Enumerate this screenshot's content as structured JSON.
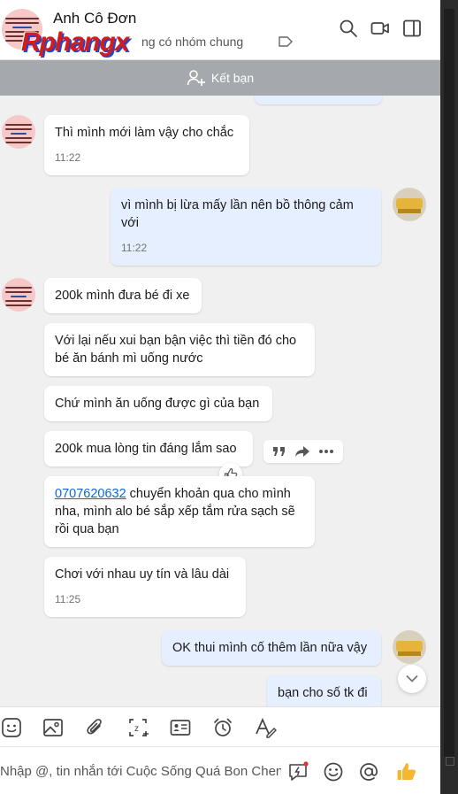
{
  "header": {
    "name": "Anh Cô Đơn",
    "subtitle": "ng có nhóm chung",
    "watermark": "Rphangx"
  },
  "friend_bar": {
    "label": "Kết bạn"
  },
  "messages": {
    "m1": {
      "text": "Thì mình mới làm vậy cho chắc",
      "time": "11:22"
    },
    "m2": {
      "text": "vì mình bị lừa mấy lần nên bồ thông cảm với",
      "time": "11:22"
    },
    "m3": {
      "text": "200k mình đưa bé đi xe"
    },
    "m4": {
      "text": "Với lại nếu xui bạn bận việc thì tiền đó cho bé ăn bánh mì uống nước"
    },
    "m5": {
      "text": "Chứ mình ăn uống được gì của bạn"
    },
    "m6": {
      "text": "200k mua lòng tin đáng lắm sao"
    },
    "m7": {
      "phone": "0707620632",
      "text": " chuyển khoản qua cho mình nha, mình alo bé sắp xếp tắm rửa sạch sẽ rồi qua bạn"
    },
    "m8": {
      "text": "Chơi với nhau uy tín và lâu dài",
      "time": "11:25"
    },
    "m9": {
      "text": "OK thui mình cố thêm lần nữa vậy"
    },
    "m10": {
      "text": "bạn cho số tk đi"
    }
  },
  "composer": {
    "placeholder": "Nhập @, tin nhắn tới Cuộc Sống Quá Bon Chen"
  },
  "colors": {
    "accent": "#0a68d8",
    "outgoing_bubble": "#e5efff",
    "incoming_bubble": "#ffffff",
    "friend_bar": "#a5a9ad",
    "like_thumb": "#f5b731"
  },
  "icons": {
    "header": [
      "search-icon",
      "video-call-icon",
      "sidebar-toggle-icon"
    ],
    "toolbar": [
      "sticker-icon",
      "image-icon",
      "attachment-icon",
      "screenshot-icon",
      "contact-card-icon",
      "reminder-icon",
      "text-format-icon"
    ],
    "composer": [
      "quick-message-icon",
      "emoji-icon",
      "mention-icon",
      "thumbs-up-icon"
    ]
  }
}
